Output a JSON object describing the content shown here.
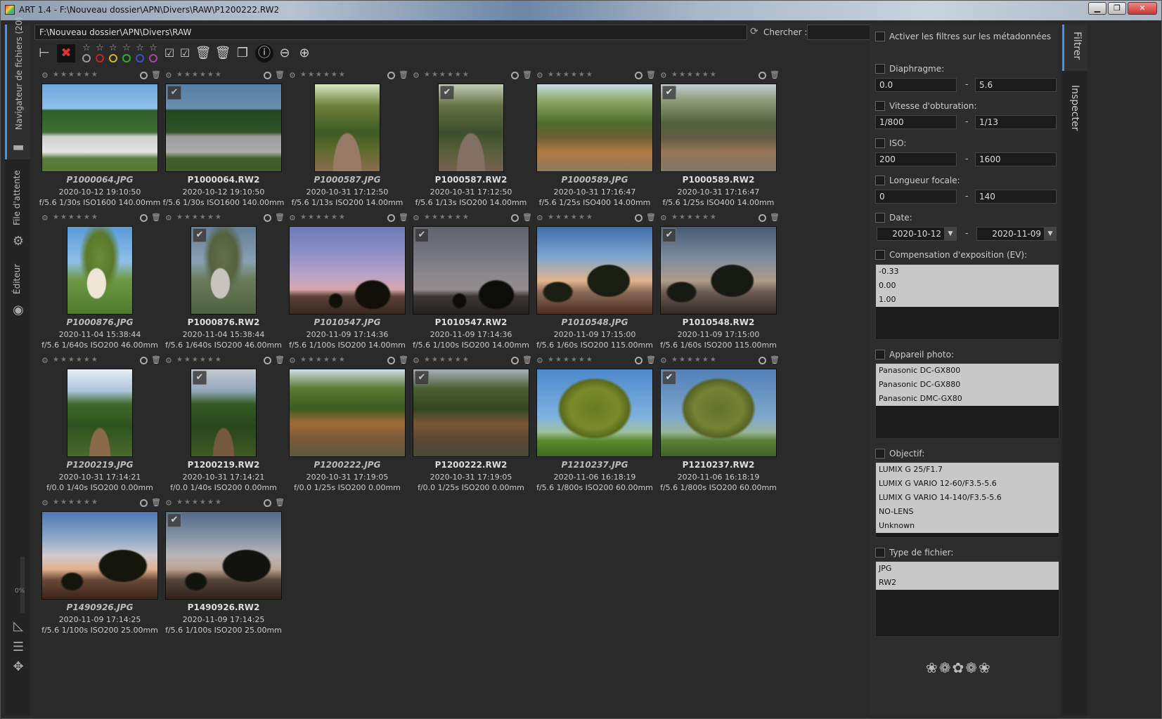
{
  "window": {
    "title": "ART 1.4 - F:\\Nouveau dossier\\APN\\Divers\\RAW\\P1200222.RW2",
    "minimize": "▁",
    "maximize": "❐",
    "close": "✕"
  },
  "left_tabs": {
    "browser": "Navigateur de fichiers (20)",
    "queue": "File d'attente",
    "editor": "Éditeur"
  },
  "progress": "0%",
  "path": "F:\\Nouveau dossier\\APN\\Divers\\RAW",
  "search": {
    "label": "Chercher :",
    "value": ""
  },
  "toolbar": {
    "stars": [
      "☆",
      "☆",
      "☆",
      "☆",
      "☆",
      "☆"
    ],
    "ring_colors": [
      "#999999",
      "#cc2222",
      "#ccbb22",
      "#33aa33",
      "#3355cc",
      "#aa44aa"
    ]
  },
  "thumbnails": [
    {
      "name": "P1000064.JPG",
      "date": "2020-10-12 19:10:50",
      "exif": "f/5.6 1/30s ISO1600 140.00mm",
      "jpg": true,
      "checked": false,
      "orient": "landscape",
      "scene": "sc-cows"
    },
    {
      "name": "P1000064.RW2",
      "date": "2020-10-12 19:10:50",
      "exif": "f/5.6 1/30s ISO1600 140.00mm",
      "jpg": false,
      "checked": true,
      "orient": "landscape",
      "scene": "sc-cows dim"
    },
    {
      "name": "P1000587.JPG",
      "date": "2020-10-31 17:12:50",
      "exif": "f/5.6 1/13s ISO200 14.00mm",
      "jpg": true,
      "checked": false,
      "orient": "portrait",
      "scene": "sc-path"
    },
    {
      "name": "P1000587.RW2",
      "date": "2020-10-31 17:12:50",
      "exif": "f/5.6 1/13s ISO200 14.00mm",
      "jpg": false,
      "checked": true,
      "orient": "portrait",
      "scene": "sc-path dim"
    },
    {
      "name": "P1000589.JPG",
      "date": "2020-10-31 17:16:47",
      "exif": "f/5.6 1/25s ISO400 14.00mm",
      "jpg": true,
      "checked": false,
      "orient": "landscape",
      "scene": "sc-forest"
    },
    {
      "name": "P1000589.RW2",
      "date": "2020-10-31 17:16:47",
      "exif": "f/5.6 1/25s ISO400 14.00mm",
      "jpg": false,
      "checked": true,
      "orient": "landscape",
      "scene": "sc-forest dim"
    },
    {
      "name": "P1000876.JPG",
      "date": "2020-11-04 15:38:44",
      "exif": "f/5.6 1/640s ISO200 46.00mm",
      "jpg": true,
      "checked": false,
      "orient": "portrait",
      "scene": "sc-cowtree"
    },
    {
      "name": "P1000876.RW2",
      "date": "2020-11-04 15:38:44",
      "exif": "f/5.6 1/640s ISO200 46.00mm",
      "jpg": false,
      "checked": true,
      "orient": "portrait",
      "scene": "sc-cowtree dim"
    },
    {
      "name": "P1010547.JPG",
      "date": "2020-11-09 17:14:36",
      "exif": "f/5.6 1/100s ISO200 14.00mm",
      "jpg": true,
      "checked": false,
      "orient": "landscape",
      "scene": "sc-dusk"
    },
    {
      "name": "P1010547.RW2",
      "date": "2020-11-09 17:14:36",
      "exif": "f/5.6 1/100s ISO200 14.00mm",
      "jpg": false,
      "checked": true,
      "orient": "landscape",
      "scene": "sc-dusk dim"
    },
    {
      "name": "P1010548.JPG",
      "date": "2020-11-09 17:15:00",
      "exif": "f/5.6 1/60s ISO200 115.00mm",
      "jpg": true,
      "checked": false,
      "orient": "landscape",
      "scene": "sc-sunset"
    },
    {
      "name": "P1010548.RW2",
      "date": "2020-11-09 17:15:00",
      "exif": "f/5.6 1/60s ISO200 115.00mm",
      "jpg": false,
      "checked": true,
      "orient": "landscape",
      "scene": "sc-sunset dim"
    },
    {
      "name": "P1200219.JPG",
      "date": "2020-10-31 17:14:21",
      "exif": "f/0.0 1/40s ISO200 0.00mm",
      "jpg": true,
      "checked": false,
      "orient": "portrait",
      "scene": "sc-trail"
    },
    {
      "name": "P1200219.RW2",
      "date": "2020-10-31 17:14:21",
      "exif": "f/0.0 1/40s ISO200 0.00mm",
      "jpg": false,
      "checked": true,
      "orient": "portrait",
      "scene": "sc-trail dim"
    },
    {
      "name": "P1200222.JPG",
      "date": "2020-10-31 17:19:05",
      "exif": "f/0.0 1/25s ISO200 0.00mm",
      "jpg": true,
      "checked": false,
      "orient": "landscape",
      "scene": "sc-woods"
    },
    {
      "name": "P1200222.RW2",
      "date": "2020-10-31 17:19:05",
      "exif": "f/0.0 1/25s ISO200 0.00mm",
      "jpg": false,
      "checked": true,
      "orient": "landscape",
      "scene": "sc-woods dim"
    },
    {
      "name": "P1210237.JPG",
      "date": "2020-11-06 16:18:19",
      "exif": "f/5.6 1/800s ISO200 60.00mm",
      "jpg": true,
      "checked": false,
      "orient": "landscape",
      "scene": "sc-oak"
    },
    {
      "name": "P1210237.RW2",
      "date": "2020-11-06 16:18:19",
      "exif": "f/5.6 1/800s ISO200 60.00mm",
      "jpg": false,
      "checked": true,
      "orient": "landscape",
      "scene": "sc-oak dim"
    },
    {
      "name": "P1490926.JPG",
      "date": "2020-11-09 17:14:25",
      "exif": "f/5.6 1/100s ISO200 25.00mm",
      "jpg": true,
      "checked": false,
      "orient": "landscape",
      "scene": "sc-dusk2"
    },
    {
      "name": "P1490926.RW2",
      "date": "2020-11-09 17:14:25",
      "exif": "f/5.6 1/100s ISO200 25.00mm",
      "jpg": false,
      "checked": true,
      "orient": "landscape",
      "scene": "sc-dusk2 dim"
    }
  ],
  "filters": {
    "metadata_toggle": "Activer les filtres sur les métadonnées",
    "aperture": {
      "label": "Diaphragme:",
      "from": "0.0",
      "to": "5.6"
    },
    "shutter": {
      "label": "Vitesse d'obturation:",
      "from": "1/800",
      "to": "1/13"
    },
    "iso": {
      "label": "ISO:",
      "from": "200",
      "to": "1600"
    },
    "focal": {
      "label": "Longueur focale:",
      "from": "0",
      "to": "140"
    },
    "date": {
      "label": "Date:",
      "from": "2020-10-12",
      "to": "2020-11-09"
    },
    "ev": {
      "label": "Compensation d'exposition (EV):",
      "items": [
        "-0.33",
        "0.00",
        "1.00"
      ]
    },
    "camera": {
      "label": "Appareil photo:",
      "items": [
        "Panasonic DC-GX800",
        "Panasonic DC-GX880",
        "Panasonic DMC-GX80"
      ]
    },
    "lens": {
      "label": "Objectif:",
      "items": [
        "LUMIX G 25/F1.7",
        "LUMIX G VARIO 12-60/F3.5-5.6",
        "LUMIX G VARIO 14-140/F3.5-5.6",
        "NO-LENS",
        "Unknown"
      ]
    },
    "filetype": {
      "label": "Type de fichier:",
      "items": [
        "JPG",
        "RW2"
      ]
    },
    "dash": "-"
  },
  "right_tabs": {
    "filter": "Filtrer",
    "inspect": "Inspecter"
  },
  "decoration": "❀❁✿❁❀"
}
